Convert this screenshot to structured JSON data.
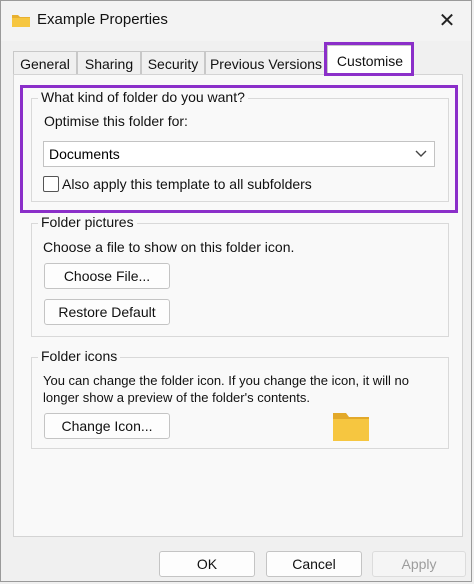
{
  "window": {
    "title": "Example Properties",
    "close_glyph": "✕"
  },
  "tabs": [
    {
      "label": "General"
    },
    {
      "label": "Sharing"
    },
    {
      "label": "Security"
    },
    {
      "label": "Previous Versions"
    },
    {
      "label": "Customise",
      "active": true
    }
  ],
  "folder_type": {
    "group_label": "What kind of folder do you want?",
    "optimise_label": "Optimise this folder for:",
    "selected": "Documents",
    "apply_subfolders_label": "Also apply this template to all subfolders",
    "apply_subfolders_checked": false
  },
  "folder_pictures": {
    "group_label": "Folder pictures",
    "description": "Choose a file to show on this folder icon.",
    "choose_file_label": "Choose File...",
    "restore_default_label": "Restore Default"
  },
  "folder_icons": {
    "group_label": "Folder icons",
    "description_line1": "You can change the folder icon. If you change the icon, it will no",
    "description_line2": "longer show a preview of the folder's contents.",
    "change_icon_label": "Change Icon..."
  },
  "footer": {
    "ok_label": "OK",
    "cancel_label": "Cancel",
    "apply_label": "Apply"
  },
  "colors": {
    "highlight": "#8b2fc9",
    "folder_yellow": "#f6c640"
  }
}
